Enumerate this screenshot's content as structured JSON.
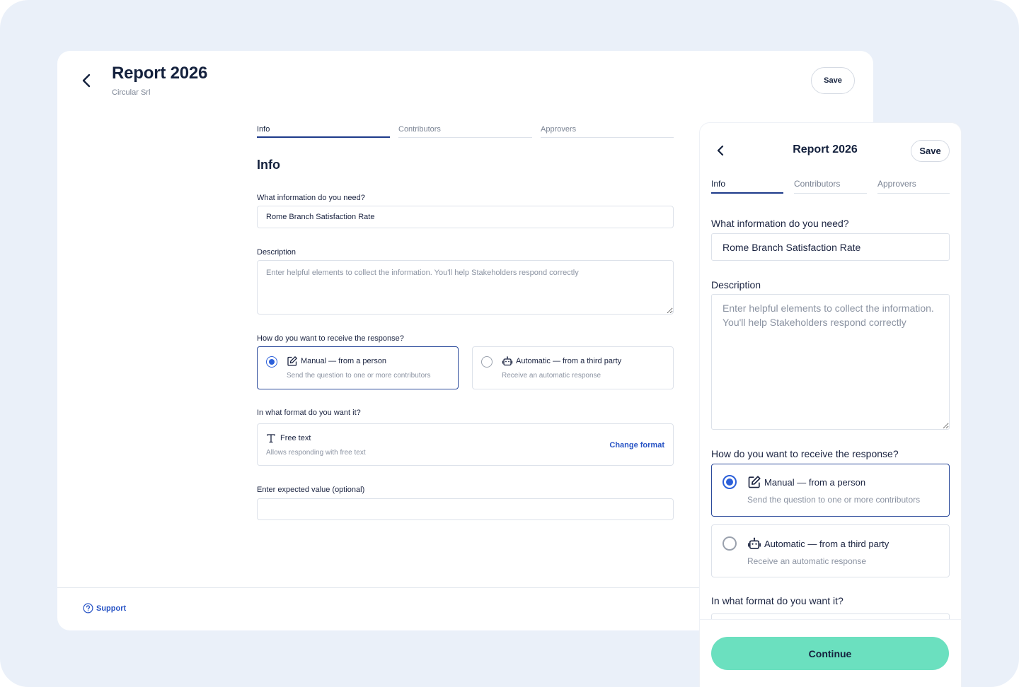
{
  "report": {
    "title": "Report 2026",
    "company": "Circular Srl",
    "save_label": "Save"
  },
  "tabs": [
    "Info",
    "Contributors",
    "Approvers"
  ],
  "section_title": "Info",
  "question": {
    "label": "What information do you need?",
    "value": "Rome Branch Satisfaction Rate"
  },
  "description": {
    "label": "Description",
    "placeholder": "Enter helpful elements to collect the information. You'll help Stakeholders respond correctly"
  },
  "response": {
    "label": "How do you want to receive the response?",
    "options": [
      {
        "title": "Manual — from a person",
        "subtitle": "Send the question to one or more contributors",
        "selected": true,
        "icon": "edit-icon"
      },
      {
        "title": "Automatic — from a third party",
        "subtitle": "Receive an automatic response",
        "selected": false,
        "icon": "robot-icon"
      }
    ]
  },
  "format": {
    "label": "In what format do you want it?",
    "title": "Free text",
    "subtitle": "Allows responding with free text",
    "change_label": "Change format",
    "icon": "text-format-icon"
  },
  "expected": {
    "label": "Enter expected value (optional)",
    "value": ""
  },
  "support_label": "Support",
  "continue_label": "Continue",
  "colors": {
    "accent": "#2753c5",
    "primary_button": "#6be0bf",
    "background": "#eaf0f9"
  }
}
